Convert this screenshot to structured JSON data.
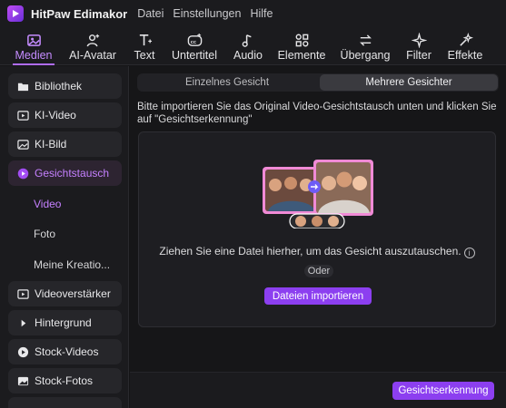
{
  "app": {
    "name": "HitPaw Edimakor",
    "menu": [
      "Datei",
      "Einstellungen",
      "Hilfe"
    ],
    "accent": "#8c3ff0"
  },
  "toolbar": {
    "items": [
      {
        "label": "Medien",
        "icon": "media-icon",
        "active": true
      },
      {
        "label": "AI-Avatar",
        "icon": "ai-avatar-icon"
      },
      {
        "label": "Text",
        "icon": "text-icon"
      },
      {
        "label": "Untertitel",
        "icon": "subtitle-icon"
      },
      {
        "label": "Audio",
        "icon": "music-note-icon"
      },
      {
        "label": "Elemente",
        "icon": "elements-icon"
      },
      {
        "label": "Übergang",
        "icon": "transition-icon"
      },
      {
        "label": "Filter",
        "icon": "sparkle-filter-icon"
      },
      {
        "label": "Effekte",
        "icon": "effects-icon"
      }
    ]
  },
  "sidebar": {
    "items": [
      {
        "label": "Bibliothek",
        "icon": "folder-icon"
      },
      {
        "label": "KI-Video",
        "icon": "ai-video-icon"
      },
      {
        "label": "KI-Bild",
        "icon": "ai-image-icon"
      },
      {
        "label": "Gesichtstausch",
        "icon": "face-swap-icon",
        "active": true
      },
      {
        "label": "Videoverstärker",
        "icon": "video-enhancer-icon"
      },
      {
        "label": "Hintergrund",
        "icon": "caret-right-icon"
      },
      {
        "label": "Stock-Videos",
        "icon": "stock-video-icon"
      },
      {
        "label": "Stock-Fotos",
        "icon": "stock-photo-icon"
      }
    ],
    "subitems": [
      {
        "label": "Video",
        "active": true
      },
      {
        "label": "Foto"
      },
      {
        "label": "Meine Kreatio..."
      }
    ]
  },
  "main": {
    "tabs": [
      {
        "label": "Einzelnes Gesicht"
      },
      {
        "label": "Mehrere Gesichter",
        "active": true
      }
    ],
    "instruction": "Bitte importieren Sie das Original Video-Gesichtstausch unten und klicken Sie auf \"Gesichtserkennung\"",
    "drop_text": "Ziehen Sie eine Datei hierher, um das Gesicht auszutauschen.",
    "oder": "Oder",
    "import_button": "Dateien importieren",
    "detect_button": "Gesichtserkennung"
  }
}
